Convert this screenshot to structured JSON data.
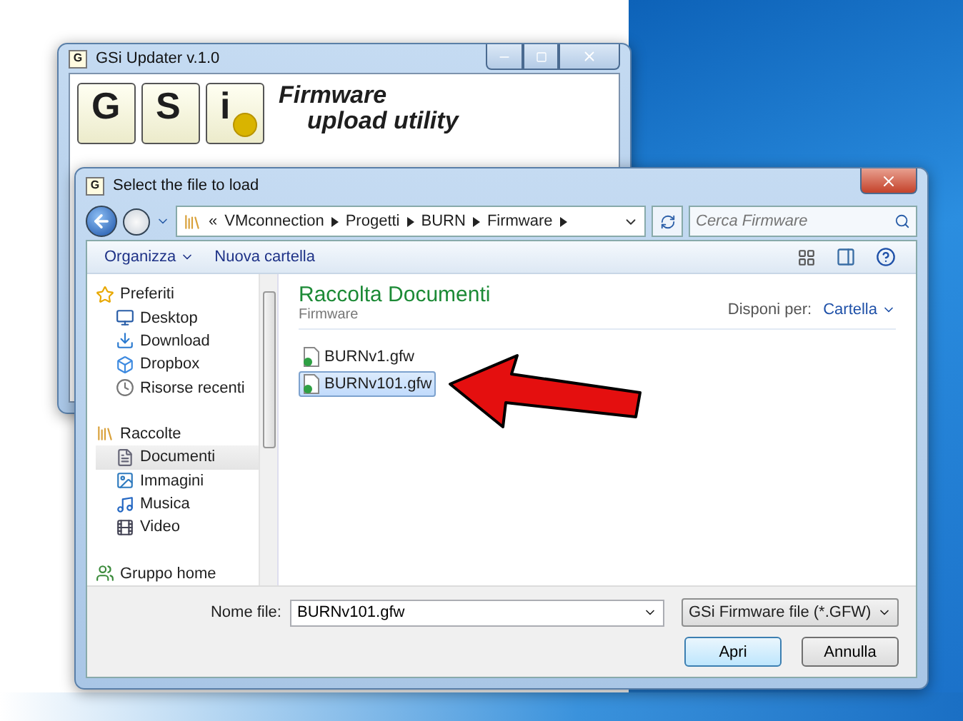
{
  "main_window": {
    "title": "GSi Updater v.1.0",
    "app_icon": "G",
    "logo_keys": [
      "G",
      "S",
      "i"
    ],
    "tagline_1": "Firmware",
    "tagline_2": "upload utility"
  },
  "dialog": {
    "title": "Select the file to load",
    "app_icon": "G",
    "path_prefix": "«",
    "path": [
      "VMconnection",
      "Progetti",
      "BURN",
      "Firmware"
    ],
    "search": {
      "placeholder": "Cerca Firmware"
    },
    "toolbar": {
      "organize": "Organizza",
      "new_folder": "Nuova cartella"
    },
    "nav": [
      {
        "label": "Preferiti",
        "selected": false,
        "children": [
          {
            "label": "Desktop",
            "selected": false
          },
          {
            "label": "Download",
            "selected": false
          },
          {
            "label": "Dropbox",
            "selected": false
          },
          {
            "label": "Risorse recenti",
            "selected": false
          }
        ]
      },
      {
        "label": "Raccolte",
        "selected": false,
        "children": [
          {
            "label": "Documenti",
            "selected": true
          },
          {
            "label": "Immagini",
            "selected": false
          },
          {
            "label": "Musica",
            "selected": false
          },
          {
            "label": "Video",
            "selected": false
          }
        ]
      },
      {
        "label": "Gruppo home",
        "selected": false
      }
    ],
    "library": {
      "title": "Raccolta Documenti",
      "subtitle": "Firmware",
      "arrange_label": "Disponi per:",
      "arrange_value": "Cartella"
    },
    "files": [
      {
        "name": "BURNv1.gfw",
        "selected": false
      },
      {
        "name": "BURNv101.gfw",
        "selected": true
      }
    ],
    "file_name_label": "Nome file:",
    "file_name": "BURNv101.gfw",
    "filter": "GSi Firmware file (*.GFW)",
    "buttons": [
      {
        "label": "Apri",
        "default": true
      },
      {
        "label": "Annulla",
        "default": false
      }
    ]
  }
}
